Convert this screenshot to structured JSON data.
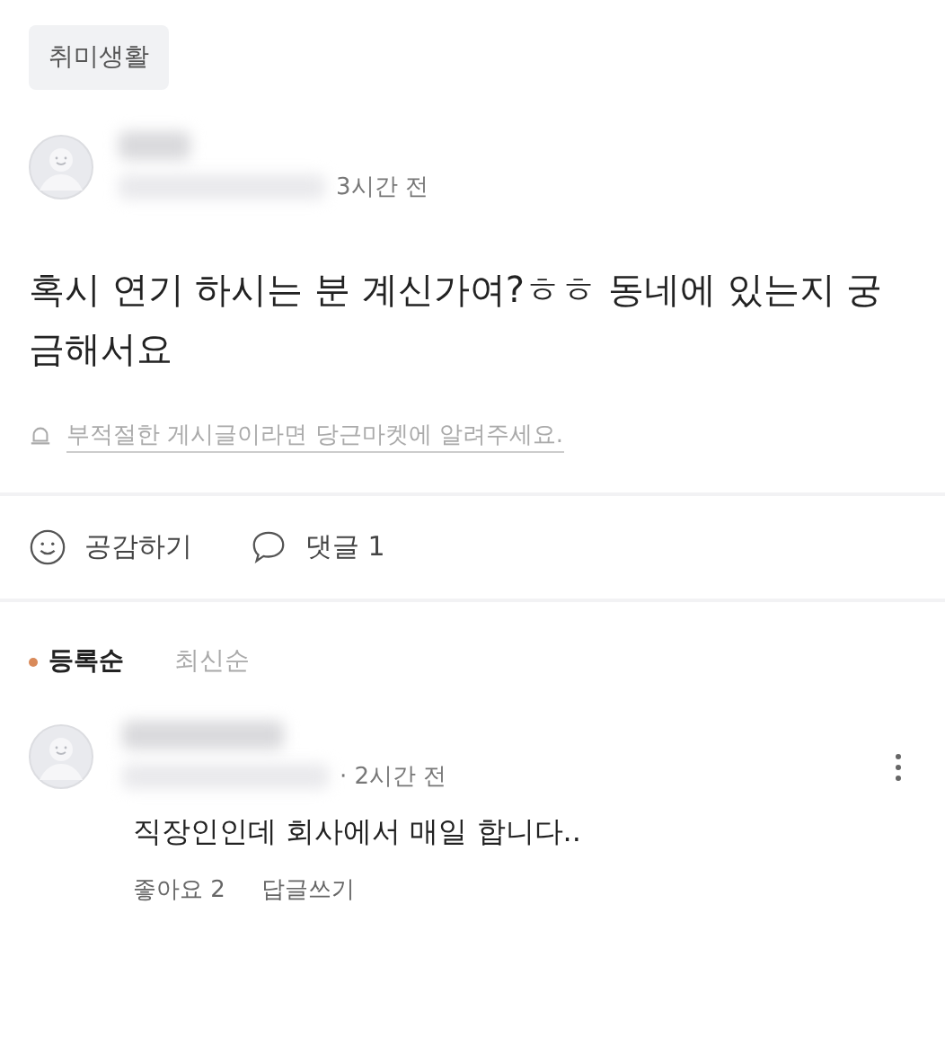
{
  "category_tag": "취미생활",
  "post": {
    "time": "3시간 전",
    "body": "혹시 연기 하시는 분 계신가여?ㅎㅎ 동네에 있는지 궁금해서요",
    "report_link": "부적절한 게시글이라면 당근마켓에 알려주세요."
  },
  "actions": [
    {
      "kind": "empathy",
      "label": "공감하기"
    },
    {
      "kind": "comment",
      "label": "댓글 1"
    }
  ],
  "sort_tabs": [
    {
      "label": "등록순",
      "selected": true
    },
    {
      "label": "최신순",
      "selected": false
    }
  ],
  "comments": [
    {
      "time": "· 2시간 전",
      "body": "직장인인데 회사에서 매일 합니다..",
      "like": "좋아요 2",
      "reply": "답글쓰기"
    }
  ]
}
